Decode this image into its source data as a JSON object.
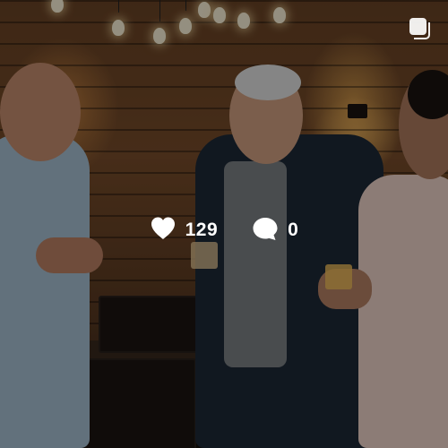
{
  "post": {
    "likes": "129",
    "comments": "0",
    "likes_icon": "heart-icon",
    "comments_icon": "comment-bubble-icon",
    "corner_icon": "multiple-posts-icon"
  },
  "colors": {
    "overlay": "rgba(0,0,0,0.42)",
    "icon": "#ffffff",
    "text": "#ffffff"
  }
}
